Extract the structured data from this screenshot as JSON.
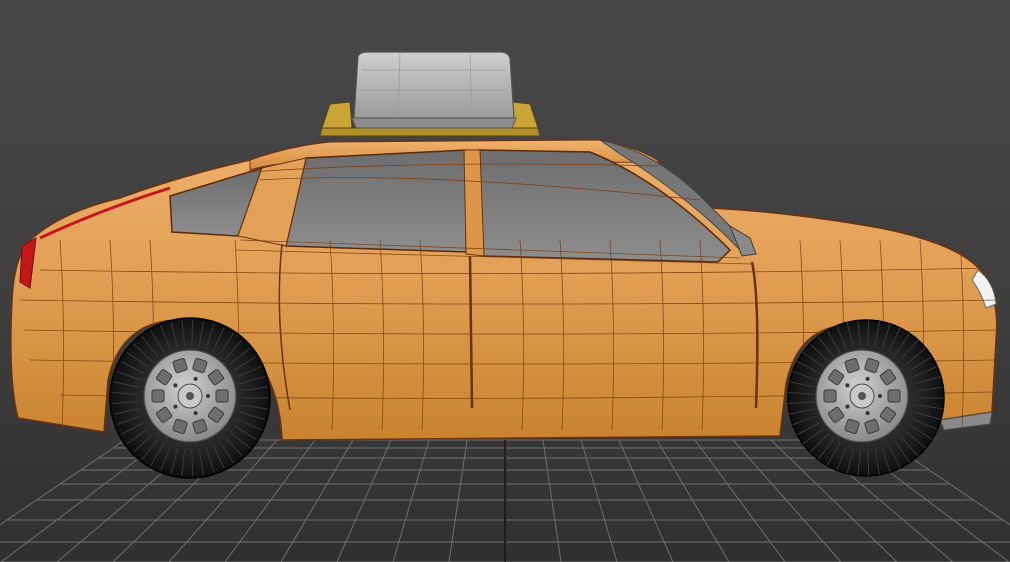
{
  "viewport": {
    "mode": "perspective-viewport",
    "shading": "shaded-with-edged-faces",
    "grid_visible": true,
    "background_color": "#454545",
    "grid_color": "#6e6e6e",
    "grid_axis_color": "#1e1e1e"
  },
  "model": {
    "kind": "taxi-sedan-wireframe-mesh",
    "body_color": "#e4a15c",
    "body_shadow_color": "#c57a2c",
    "wire_color": "#7a3b0e",
    "window_color": "#808080",
    "roof_sign_color": "#b9b9b9",
    "sign_base_color": "#c9a535",
    "tail_light_color": "#c21818",
    "tire_color": "#1a1a1a",
    "wheel_rim_color": "#a8a8a8"
  }
}
